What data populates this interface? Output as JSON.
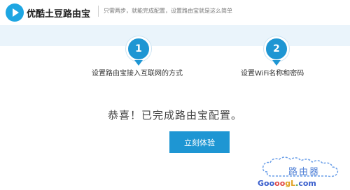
{
  "header": {
    "app_title": "优酷土豆路由宝",
    "tagline": "只需两步，就能完成配置，设置路由宝就是这么简单"
  },
  "steps": [
    {
      "number": "1",
      "label": "设置路由宝接入互联网的方式"
    },
    {
      "number": "2",
      "label": "设置WiFi名称和密码"
    }
  ],
  "main": {
    "congrats_text": "恭喜！已完成路由宝配置。",
    "cta_label": "立刻体验"
  },
  "watermark": {
    "text": "路由器",
    "url_parts": [
      "Goo",
      "oo",
      "gL",
      ".",
      "com"
    ],
    "colors": {
      "primary": "#1e96d3",
      "band": "#eaf4fb"
    }
  }
}
